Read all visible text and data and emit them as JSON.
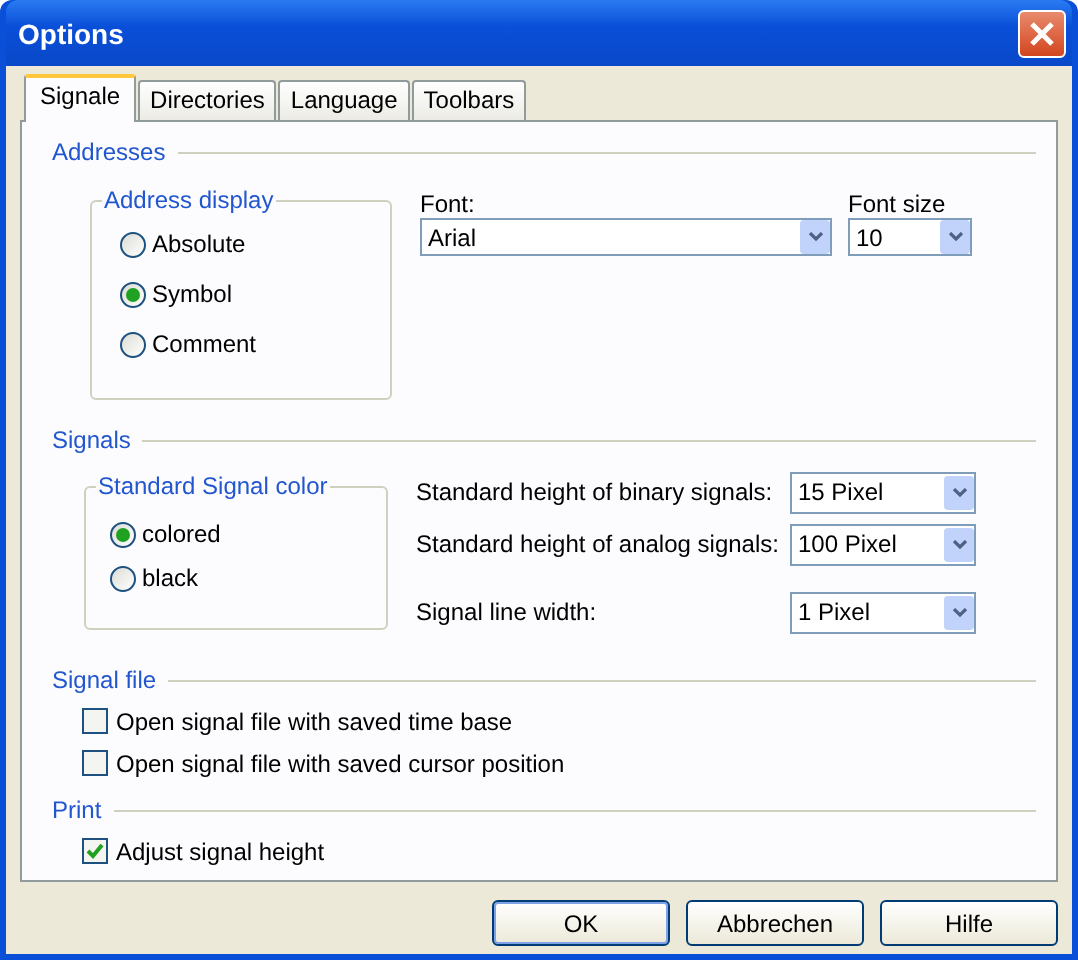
{
  "window": {
    "title": "Options"
  },
  "tabs": [
    {
      "label": "Signale",
      "selected": true
    },
    {
      "label": "Directories",
      "selected": false
    },
    {
      "label": "Language",
      "selected": false
    },
    {
      "label": "Toolbars",
      "selected": false
    }
  ],
  "addresses": {
    "heading": "Addresses",
    "address_display": {
      "legend": "Address display",
      "options": [
        {
          "label": "Absolute",
          "selected": false
        },
        {
          "label": "Symbol",
          "selected": true
        },
        {
          "label": "Comment",
          "selected": false
        }
      ]
    },
    "font": {
      "label": "Font:",
      "value": "Arial"
    },
    "font_size": {
      "label": "Font size",
      "value": "10"
    }
  },
  "signals": {
    "heading": "Signals",
    "signal_color": {
      "legend": "Standard Signal color",
      "options": [
        {
          "label": "colored",
          "selected": true
        },
        {
          "label": "black",
          "selected": false
        }
      ]
    },
    "settings": [
      {
        "label": "Standard height of binary signals:",
        "value": "15 Pixel"
      },
      {
        "label": "Standard height of analog signals:",
        "value": "100 Pixel"
      },
      {
        "label": "Signal line width:",
        "value": "1 Pixel"
      }
    ]
  },
  "signal_file": {
    "heading": "Signal file",
    "checkboxes": [
      {
        "label": "Open signal file with saved time base",
        "checked": false
      },
      {
        "label": "Open signal file with saved cursor position",
        "checked": false
      }
    ]
  },
  "print": {
    "heading": "Print",
    "checkboxes": [
      {
        "label": "Adjust signal height",
        "checked": true
      }
    ]
  },
  "buttons": [
    {
      "label": "OK",
      "default": true
    },
    {
      "label": "Abbrechen",
      "default": false
    },
    {
      "label": "Hilfe",
      "default": false
    }
  ]
}
